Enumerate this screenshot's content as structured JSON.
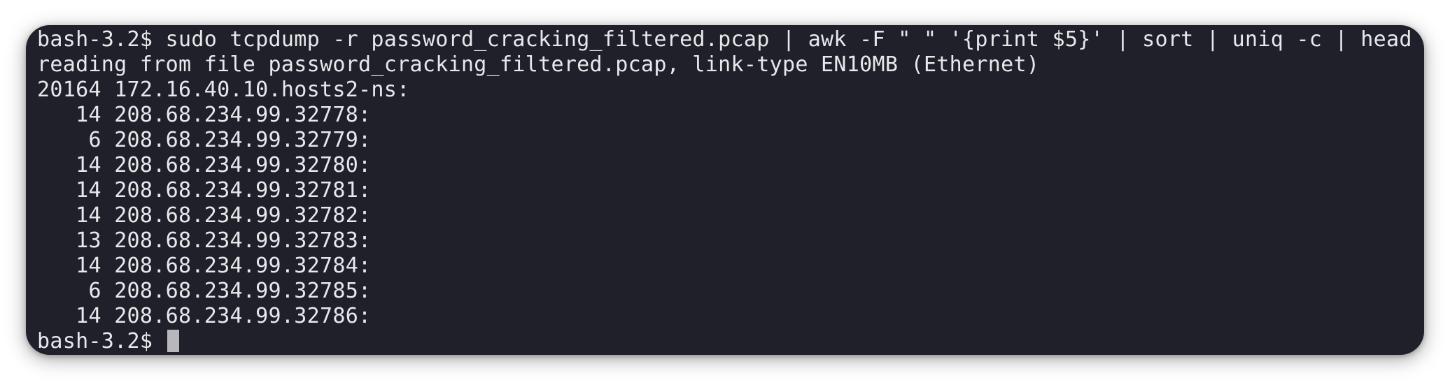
{
  "terminal": {
    "prompt": "bash-3.2$ ",
    "command": "sudo tcpdump -r password_cracking_filtered.pcap | awk -F \" \" '{print $5}' | sort | uniq -c | head",
    "info_line": "reading from file password_cracking_filtered.pcap, link-type EN10MB (Ethernet)",
    "output_rows": [
      {
        "count": "20164",
        "host": "172.16.40.10.hosts2-ns:"
      },
      {
        "count": "   14",
        "host": "208.68.234.99.32778:"
      },
      {
        "count": "    6",
        "host": "208.68.234.99.32779:"
      },
      {
        "count": "   14",
        "host": "208.68.234.99.32780:"
      },
      {
        "count": "   14",
        "host": "208.68.234.99.32781:"
      },
      {
        "count": "   14",
        "host": "208.68.234.99.32782:"
      },
      {
        "count": "   13",
        "host": "208.68.234.99.32783:"
      },
      {
        "count": "   14",
        "host": "208.68.234.99.32784:"
      },
      {
        "count": "    6",
        "host": "208.68.234.99.32785:"
      },
      {
        "count": "   14",
        "host": "208.68.234.99.32786:"
      }
    ],
    "final_prompt": "bash-3.2$ "
  },
  "colors": {
    "background": "#20202a",
    "text": "#e8e8ec",
    "cursor": "#b8b8bc"
  }
}
